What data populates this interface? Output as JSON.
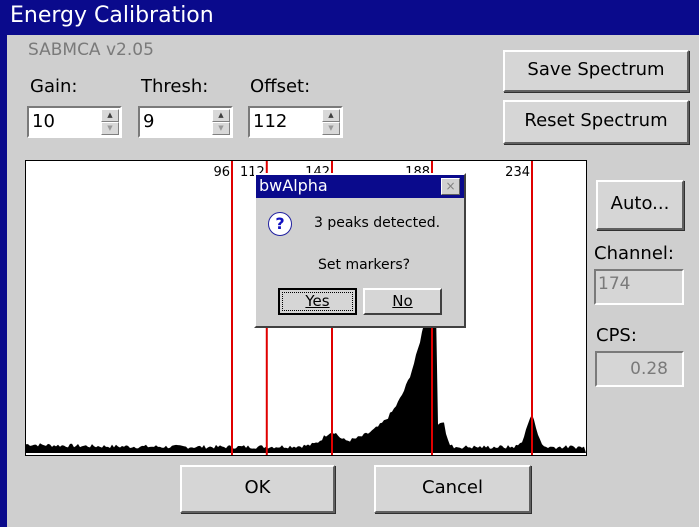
{
  "window": {
    "title": "Energy Calibration"
  },
  "version": "SABMCA v2.05",
  "controls": {
    "gain": {
      "label": "Gain:",
      "value": "10"
    },
    "thresh": {
      "label": "Thresh:",
      "value": "9"
    },
    "offset": {
      "label": "Offset:",
      "value": "112"
    }
  },
  "buttons": {
    "save": "Save Spectrum",
    "reset": "Reset Spectrum",
    "auto": "Auto...",
    "ok": "OK",
    "cancel": "Cancel"
  },
  "side": {
    "channel_label": "Channel:",
    "channel_value": "174",
    "cps_label": "CPS:",
    "cps_value": "0.28"
  },
  "markers": [
    {
      "label": "96",
      "channel": 96
    },
    {
      "label": "112",
      "channel": 112
    },
    {
      "label": "142",
      "channel": 142
    },
    {
      "label": "188",
      "channel": 188
    },
    {
      "label": "234",
      "channel": 234
    }
  ],
  "colors": {
    "titlebar": "#0a0a8c",
    "marker": "#e00000"
  },
  "dialog": {
    "title": "bwAlpha",
    "message": "3 peaks detected.",
    "question": "Set markers?",
    "yes": "Yes",
    "no": "No",
    "icon": "question-icon"
  }
}
